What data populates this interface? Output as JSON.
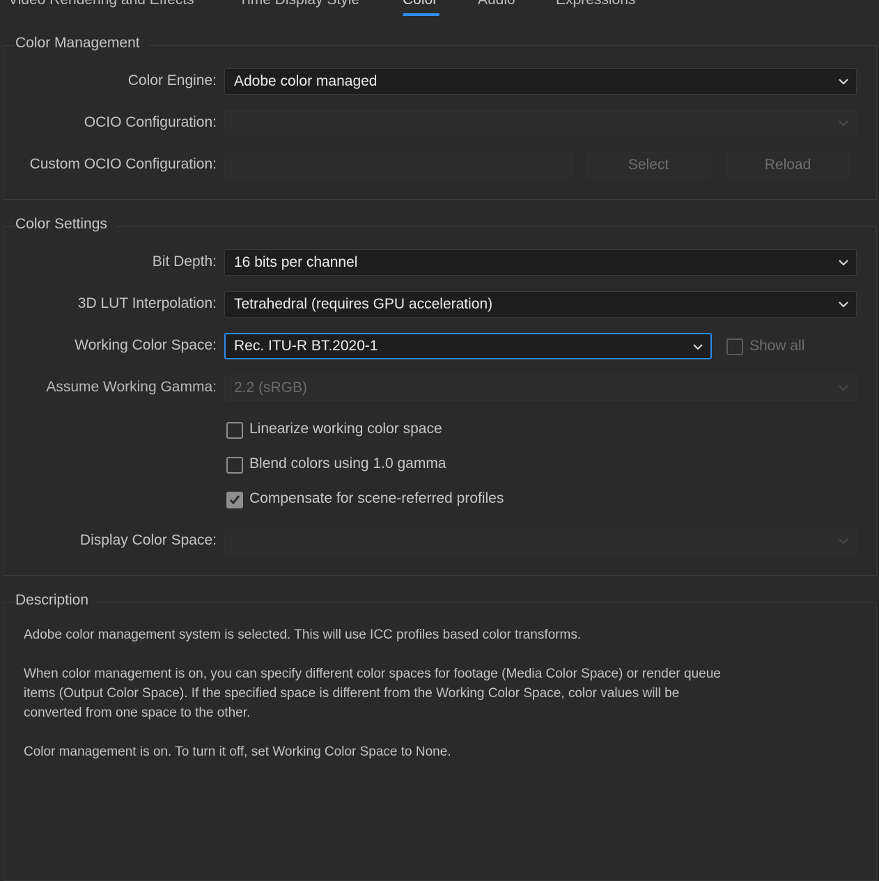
{
  "tabs": [
    {
      "label": "Video Rendering and Effects",
      "active": false
    },
    {
      "label": "Time Display Style",
      "active": false
    },
    {
      "label": "Color",
      "active": true
    },
    {
      "label": "Audio",
      "active": false
    },
    {
      "label": "Expressions",
      "active": false
    }
  ],
  "accent_color": "#2d8ceb",
  "color_management": {
    "title": "Color Management",
    "color_engine": {
      "label": "Color Engine:",
      "value": "Adobe color managed"
    },
    "ocio_configuration": {
      "label": "OCIO Configuration:",
      "value": "",
      "disabled": true
    },
    "custom_ocio_configuration": {
      "label": "Custom OCIO Configuration:",
      "value": "",
      "disabled": true
    },
    "select_button": "Select",
    "reload_button": "Reload"
  },
  "color_settings": {
    "title": "Color Settings",
    "bit_depth": {
      "label": "Bit Depth:",
      "value": "16 bits per channel"
    },
    "lut_interpolation": {
      "label": "3D LUT Interpolation:",
      "value": "Tetrahedral (requires GPU acceleration)"
    },
    "working_color_space": {
      "label": "Working Color Space:",
      "value": "Rec. ITU-R BT.2020-1",
      "focused": true
    },
    "show_all": {
      "label": "Show all",
      "checked": false,
      "disabled": true
    },
    "assume_working_gamma": {
      "label": "Assume Working Gamma:",
      "value": "2.2 (sRGB)",
      "disabled": true
    },
    "linearize": {
      "label": "Linearize working color space",
      "checked": false
    },
    "blend_colors": {
      "label": "Blend colors using 1.0 gamma",
      "checked": false
    },
    "compensate": {
      "label": "Compensate for scene-referred profiles",
      "checked": true
    },
    "display_color_space": {
      "label": "Display Color Space:",
      "value": "",
      "disabled": true
    }
  },
  "description": {
    "title": "Description",
    "paragraphs": [
      "Adobe color management system is selected. This will use ICC profiles based color transforms.",
      "When color management is on, you can specify different color spaces for footage (Media Color Space) or render queue items (Output Color Space). If the specified space is different from the Working Color Space, color values will be converted from one space to the other.",
      "Color management is on. To turn it off, set Working Color Space to None."
    ]
  }
}
